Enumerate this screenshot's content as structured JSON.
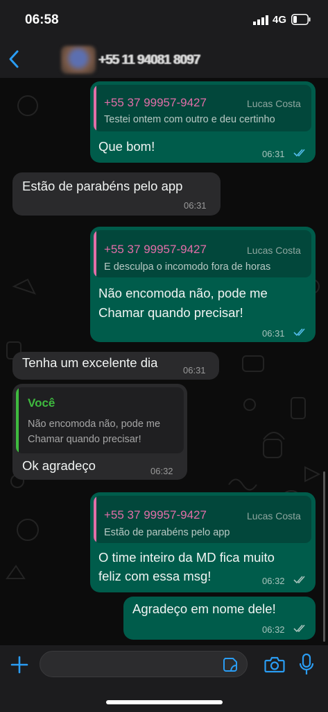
{
  "status_bar": {
    "time": "06:58",
    "network": "4G"
  },
  "header": {
    "contact_name": "+55 11 94081 8097"
  },
  "colors": {
    "outgoing_bubble": "#005c4b",
    "incoming_bubble": "#2a2a2c",
    "quote_name": "#e26ea8",
    "quote_bar_other": "#e26ea8",
    "quote_bar_you": "#3fbb3f",
    "read_ticks": "#53bdeb",
    "accent_icons": "#2a9df4"
  },
  "messages": [
    {
      "direction": "out",
      "quote": {
        "name": "+55 37 99957-9427",
        "alias": "Lucas Costa",
        "text": "Testei ontem com outro e deu certinho"
      },
      "text": "Que bom!",
      "time": "06:31",
      "status": "read"
    },
    {
      "direction": "in",
      "text": "Estão de parabéns pelo app",
      "time": "06:31"
    },
    {
      "direction": "out",
      "quote": {
        "name": "+55 37 99957-9427",
        "alias": "Lucas Costa",
        "text": "E desculpa o incomodo fora de horas"
      },
      "text_lines": [
        "Não encomoda não, pode me",
        "Chamar quando precisar!"
      ],
      "time": "06:31",
      "status": "read"
    },
    {
      "direction": "in",
      "text": "Tenha um excelente dia",
      "time": "06:31"
    },
    {
      "direction": "in",
      "quote": {
        "name": "Você",
        "text_lines": [
          "Não encomoda não, pode me",
          "Chamar quando precisar!"
        ]
      },
      "text": "Ok agradeço",
      "time": "06:32"
    },
    {
      "direction": "out",
      "quote": {
        "name": "+55 37 99957-9427",
        "alias": "Lucas Costa",
        "text": "Estão de parabéns pelo app"
      },
      "text_lines": [
        "O time inteiro da MD fica muito",
        "feliz com essa msg!"
      ],
      "time": "06:32",
      "status": "delivered"
    },
    {
      "direction": "out",
      "text": "Agradeço em nome dele!",
      "time": "06:32",
      "status": "delivered"
    }
  ],
  "composer": {
    "icons": [
      "plus-icon",
      "sticker-icon",
      "camera-icon",
      "microphone-icon"
    ]
  }
}
